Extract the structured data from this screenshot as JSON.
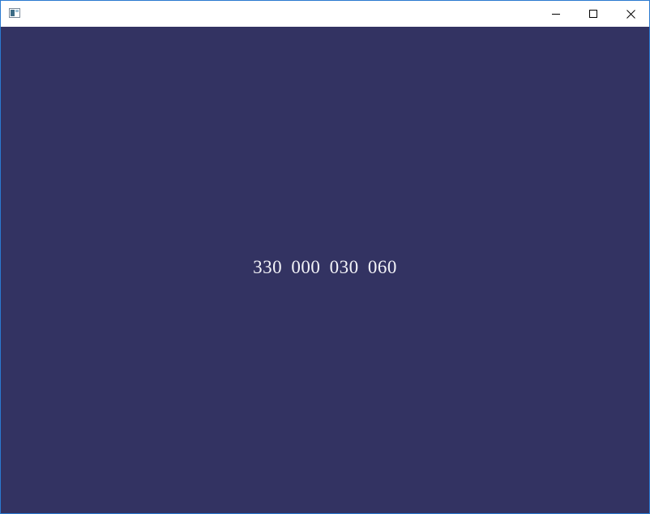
{
  "window": {
    "title": "",
    "icon": "app-window-icon",
    "controls": {
      "minimize_icon": "minimize-icon",
      "maximize_icon": "maximize-icon",
      "close_icon": "close-icon"
    }
  },
  "content": {
    "background_color": "#333362",
    "text_color": "#f4f4f8",
    "display_text": "330 000 030 060"
  },
  "colors": {
    "window_border": "#2b79d0",
    "titlebar": "#ffffff"
  }
}
